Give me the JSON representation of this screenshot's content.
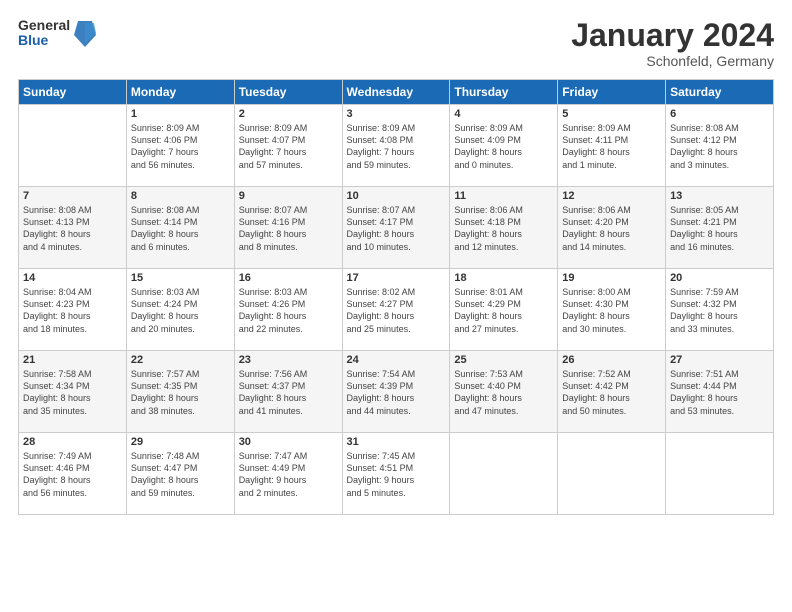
{
  "logo": {
    "general": "General",
    "blue": "Blue"
  },
  "title": "January 2024",
  "subtitle": "Schonfeld, Germany",
  "days_header": [
    "Sunday",
    "Monday",
    "Tuesday",
    "Wednesday",
    "Thursday",
    "Friday",
    "Saturday"
  ],
  "weeks": [
    [
      {
        "num": "",
        "sunrise": "",
        "sunset": "",
        "daylight": ""
      },
      {
        "num": "1",
        "sunrise": "Sunrise: 8:09 AM",
        "sunset": "Sunset: 4:06 PM",
        "daylight": "Daylight: 7 hours and 56 minutes."
      },
      {
        "num": "2",
        "sunrise": "Sunrise: 8:09 AM",
        "sunset": "Sunset: 4:07 PM",
        "daylight": "Daylight: 7 hours and 57 minutes."
      },
      {
        "num": "3",
        "sunrise": "Sunrise: 8:09 AM",
        "sunset": "Sunset: 4:08 PM",
        "daylight": "Daylight: 7 hours and 59 minutes."
      },
      {
        "num": "4",
        "sunrise": "Sunrise: 8:09 AM",
        "sunset": "Sunset: 4:09 PM",
        "daylight": "Daylight: 8 hours and 0 minutes."
      },
      {
        "num": "5",
        "sunrise": "Sunrise: 8:09 AM",
        "sunset": "Sunset: 4:11 PM",
        "daylight": "Daylight: 8 hours and 1 minute."
      },
      {
        "num": "6",
        "sunrise": "Sunrise: 8:08 AM",
        "sunset": "Sunset: 4:12 PM",
        "daylight": "Daylight: 8 hours and 3 minutes."
      }
    ],
    [
      {
        "num": "7",
        "sunrise": "Sunrise: 8:08 AM",
        "sunset": "Sunset: 4:13 PM",
        "daylight": "Daylight: 8 hours and 4 minutes."
      },
      {
        "num": "8",
        "sunrise": "Sunrise: 8:08 AM",
        "sunset": "Sunset: 4:14 PM",
        "daylight": "Daylight: 8 hours and 6 minutes."
      },
      {
        "num": "9",
        "sunrise": "Sunrise: 8:07 AM",
        "sunset": "Sunset: 4:16 PM",
        "daylight": "Daylight: 8 hours and 8 minutes."
      },
      {
        "num": "10",
        "sunrise": "Sunrise: 8:07 AM",
        "sunset": "Sunset: 4:17 PM",
        "daylight": "Daylight: 8 hours and 10 minutes."
      },
      {
        "num": "11",
        "sunrise": "Sunrise: 8:06 AM",
        "sunset": "Sunset: 4:18 PM",
        "daylight": "Daylight: 8 hours and 12 minutes."
      },
      {
        "num": "12",
        "sunrise": "Sunrise: 8:06 AM",
        "sunset": "Sunset: 4:20 PM",
        "daylight": "Daylight: 8 hours and 14 minutes."
      },
      {
        "num": "13",
        "sunrise": "Sunrise: 8:05 AM",
        "sunset": "Sunset: 4:21 PM",
        "daylight": "Daylight: 8 hours and 16 minutes."
      }
    ],
    [
      {
        "num": "14",
        "sunrise": "Sunrise: 8:04 AM",
        "sunset": "Sunset: 4:23 PM",
        "daylight": "Daylight: 8 hours and 18 minutes."
      },
      {
        "num": "15",
        "sunrise": "Sunrise: 8:03 AM",
        "sunset": "Sunset: 4:24 PM",
        "daylight": "Daylight: 8 hours and 20 minutes."
      },
      {
        "num": "16",
        "sunrise": "Sunrise: 8:03 AM",
        "sunset": "Sunset: 4:26 PM",
        "daylight": "Daylight: 8 hours and 22 minutes."
      },
      {
        "num": "17",
        "sunrise": "Sunrise: 8:02 AM",
        "sunset": "Sunset: 4:27 PM",
        "daylight": "Daylight: 8 hours and 25 minutes."
      },
      {
        "num": "18",
        "sunrise": "Sunrise: 8:01 AM",
        "sunset": "Sunset: 4:29 PM",
        "daylight": "Daylight: 8 hours and 27 minutes."
      },
      {
        "num": "19",
        "sunrise": "Sunrise: 8:00 AM",
        "sunset": "Sunset: 4:30 PM",
        "daylight": "Daylight: 8 hours and 30 minutes."
      },
      {
        "num": "20",
        "sunrise": "Sunrise: 7:59 AM",
        "sunset": "Sunset: 4:32 PM",
        "daylight": "Daylight: 8 hours and 33 minutes."
      }
    ],
    [
      {
        "num": "21",
        "sunrise": "Sunrise: 7:58 AM",
        "sunset": "Sunset: 4:34 PM",
        "daylight": "Daylight: 8 hours and 35 minutes."
      },
      {
        "num": "22",
        "sunrise": "Sunrise: 7:57 AM",
        "sunset": "Sunset: 4:35 PM",
        "daylight": "Daylight: 8 hours and 38 minutes."
      },
      {
        "num": "23",
        "sunrise": "Sunrise: 7:56 AM",
        "sunset": "Sunset: 4:37 PM",
        "daylight": "Daylight: 8 hours and 41 minutes."
      },
      {
        "num": "24",
        "sunrise": "Sunrise: 7:54 AM",
        "sunset": "Sunset: 4:39 PM",
        "daylight": "Daylight: 8 hours and 44 minutes."
      },
      {
        "num": "25",
        "sunrise": "Sunrise: 7:53 AM",
        "sunset": "Sunset: 4:40 PM",
        "daylight": "Daylight: 8 hours and 47 minutes."
      },
      {
        "num": "26",
        "sunrise": "Sunrise: 7:52 AM",
        "sunset": "Sunset: 4:42 PM",
        "daylight": "Daylight: 8 hours and 50 minutes."
      },
      {
        "num": "27",
        "sunrise": "Sunrise: 7:51 AM",
        "sunset": "Sunset: 4:44 PM",
        "daylight": "Daylight: 8 hours and 53 minutes."
      }
    ],
    [
      {
        "num": "28",
        "sunrise": "Sunrise: 7:49 AM",
        "sunset": "Sunset: 4:46 PM",
        "daylight": "Daylight: 8 hours and 56 minutes."
      },
      {
        "num": "29",
        "sunrise": "Sunrise: 7:48 AM",
        "sunset": "Sunset: 4:47 PM",
        "daylight": "Daylight: 8 hours and 59 minutes."
      },
      {
        "num": "30",
        "sunrise": "Sunrise: 7:47 AM",
        "sunset": "Sunset: 4:49 PM",
        "daylight": "Daylight: 9 hours and 2 minutes."
      },
      {
        "num": "31",
        "sunrise": "Sunrise: 7:45 AM",
        "sunset": "Sunset: 4:51 PM",
        "daylight": "Daylight: 9 hours and 5 minutes."
      },
      {
        "num": "",
        "sunrise": "",
        "sunset": "",
        "daylight": ""
      },
      {
        "num": "",
        "sunrise": "",
        "sunset": "",
        "daylight": ""
      },
      {
        "num": "",
        "sunrise": "",
        "sunset": "",
        "daylight": ""
      }
    ]
  ]
}
